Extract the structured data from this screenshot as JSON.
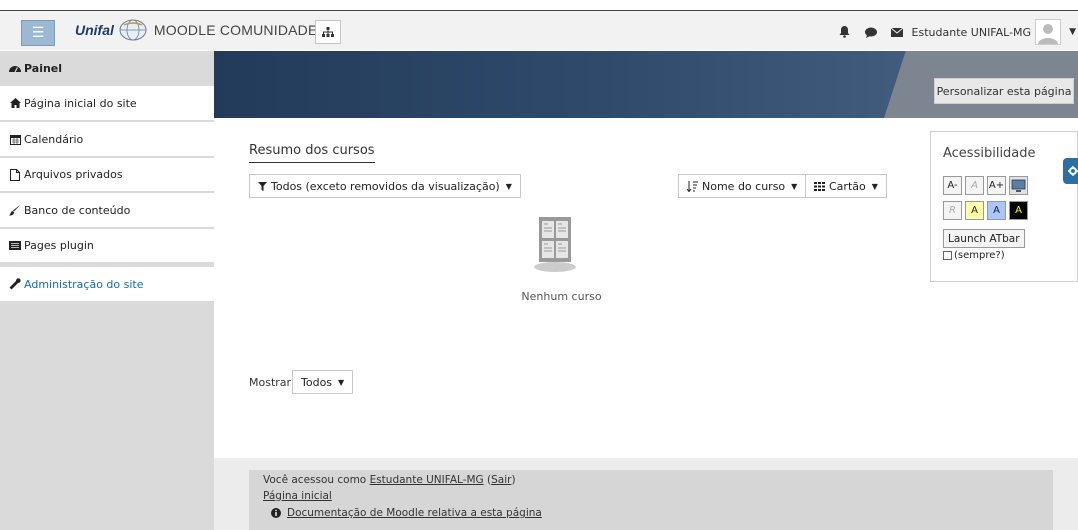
{
  "navbar": {
    "brand_logo": "Unifal",
    "brand_title": "MOODLE COMUNIDADE",
    "user_name": "Estudante UNIFAL-MG"
  },
  "sidebar": {
    "items": [
      {
        "label": "Painel",
        "icon": "dashboard-icon"
      },
      {
        "label": "Página inicial do site",
        "icon": "home-icon"
      },
      {
        "label": "Calendário",
        "icon": "calendar-icon"
      },
      {
        "label": "Arquivos privados",
        "icon": "file-icon"
      },
      {
        "label": "Banco de conteúdo",
        "icon": "brush-icon"
      },
      {
        "label": "Pages plugin",
        "icon": "pages-icon"
      },
      {
        "label": "Administração do site",
        "icon": "wrench-icon"
      }
    ]
  },
  "header": {
    "customise_label": "Personalizar esta página"
  },
  "course_overview": {
    "title": "Resumo dos cursos",
    "filter_label": "Todos (exceto removidos da visualização)",
    "sort_label": "Nome do curso",
    "view_label": "Cartão",
    "empty_text": "Nenhum curso",
    "show_label": "Mostrar",
    "show_value": "Todos"
  },
  "accessibility": {
    "title": "Acessibilidade",
    "row1": [
      "A-",
      "A",
      "A+"
    ],
    "row2": [
      "R",
      "A",
      "A",
      "A"
    ],
    "launch_label": "Launch ATbar",
    "always_label": "(sempre?)"
  },
  "footer": {
    "logged_prefix": "Você acessou como ",
    "user_link": "Estudante UNIFAL-MG",
    "logout_link": "Sair",
    "home_link": "Página inicial",
    "docs_link": "Documentação de Moodle relativa a esta página"
  },
  "colors": {
    "accent": "#0f6cbf",
    "banner": "#2f4a6b",
    "toggle": "#9db8d2"
  }
}
